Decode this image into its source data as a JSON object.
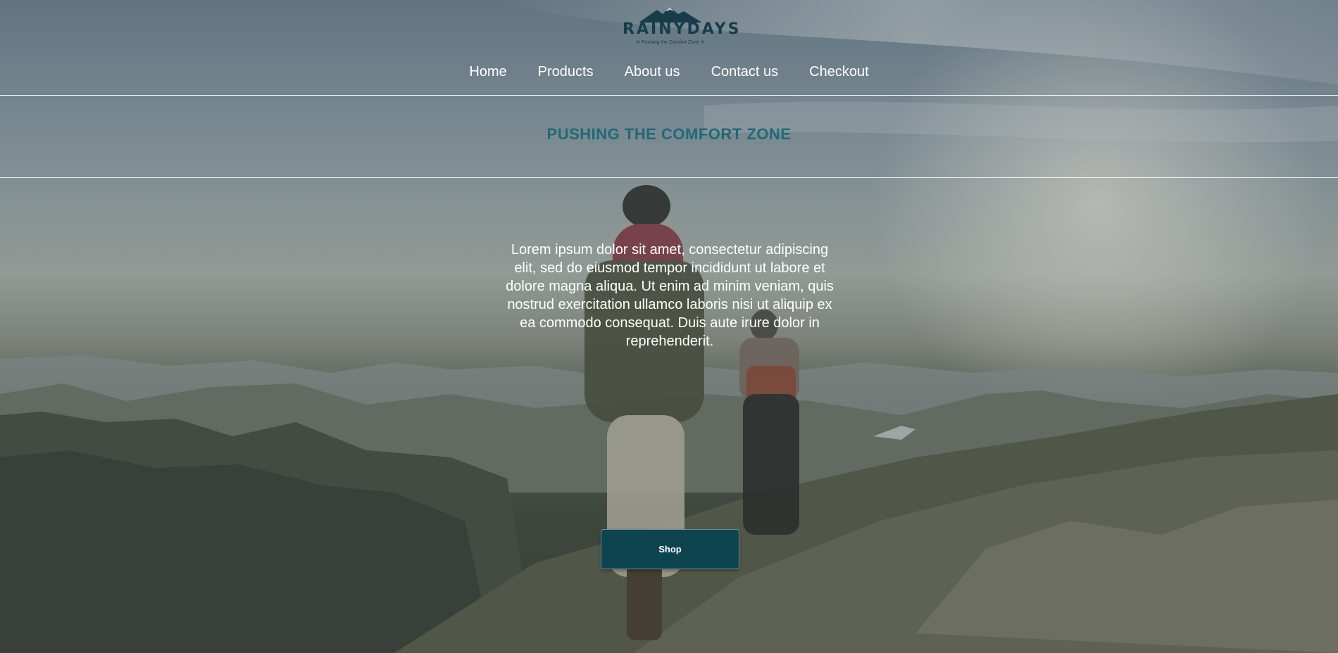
{
  "brand": {
    "name": "RAINYDAYS",
    "tagline": "✕ Pushing the Comfort Zone ✕"
  },
  "nav": {
    "items": [
      {
        "label": "Home"
      },
      {
        "label": "Products"
      },
      {
        "label": "About us"
      },
      {
        "label": "Contact us"
      },
      {
        "label": "Checkout"
      }
    ]
  },
  "hero": {
    "heading": "PUSHING THE COMFORT ZONE",
    "body": "Lorem ipsum dolor sit amet, consectetur adipiscing elit, sed do eiusmod tempor incididunt ut labore et dolore magna aliqua. Ut enim ad minim veniam, quis nostrud exercitation ullamco laboris nisi ut aliquip ex ea commodo consequat. Duis aute irure dolor in reprehenderit.",
    "cta_label": "Shop"
  },
  "colors": {
    "brand_dark": "#173d4a",
    "heading_teal": "#1f6a78",
    "button_bg": "#0d4450"
  }
}
